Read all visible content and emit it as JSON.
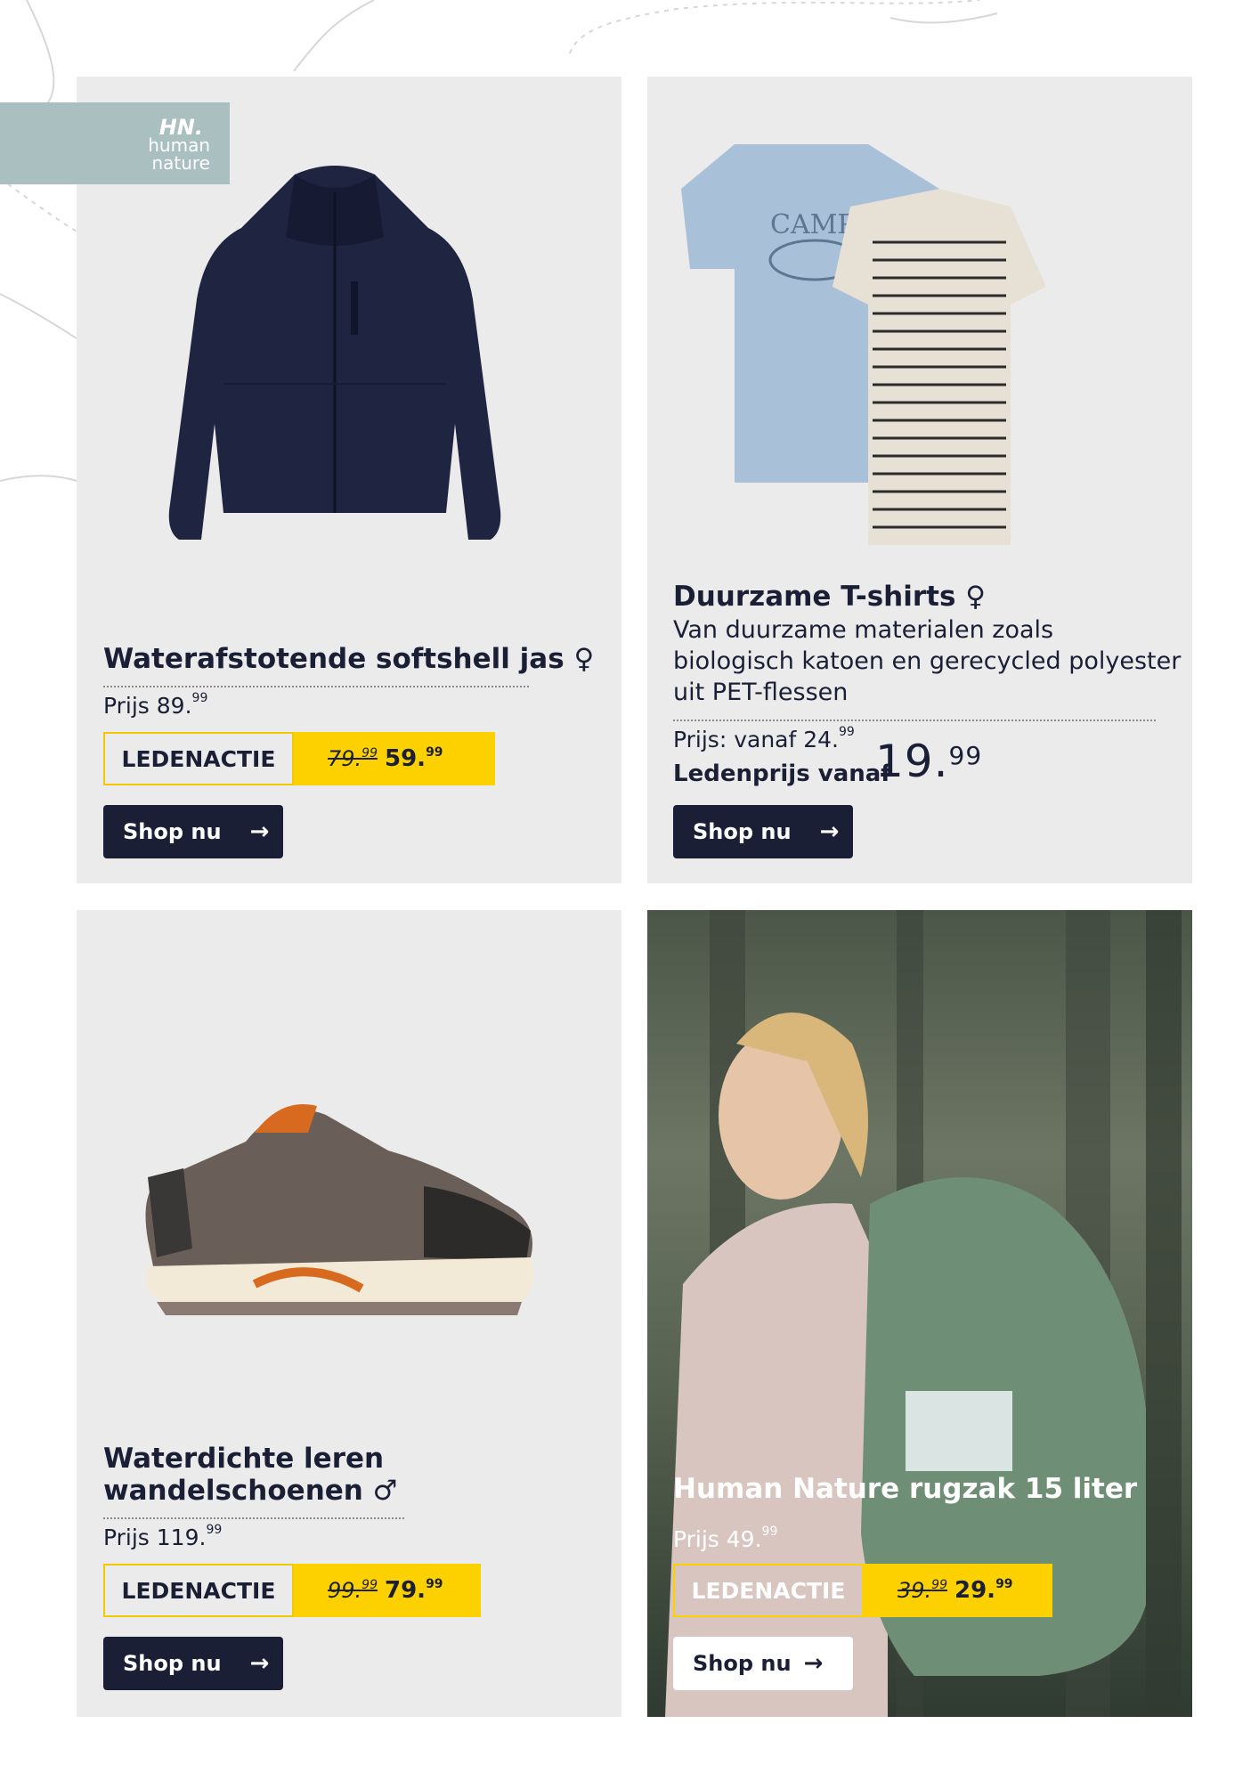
{
  "brand": {
    "mark": "HN.",
    "line1": "human",
    "line2": "nature",
    "color": "#a9bfc0"
  },
  "colors": {
    "navy": "#1a1f36",
    "yellow": "#fdd100",
    "card": "#ebebeb"
  },
  "products": [
    {
      "title": "Waterafstotende softshell jas ♀",
      "price_label": "Prijs 89.",
      "price_cents": "99",
      "member_label": "LEDENACTIE",
      "old_price": "79.",
      "old_cents": "99",
      "new_price": "59.",
      "new_cents": "99",
      "button": "Shop nu"
    },
    {
      "title": "Duurzame T-shirts ♀",
      "description_1": "Van duurzame materialen zoals",
      "description_2": "biologisch katoen en gerecycled polyester",
      "description_3": "uit PET-flessen",
      "price_label": "Prijs: vanaf 24.",
      "price_cents": "99",
      "member_price_label": "Ledenprijs  vanaf",
      "member_price": "19.",
      "member_cents": "99",
      "button": "Shop nu"
    },
    {
      "title_1": "Waterdichte leren",
      "title_2": "wandelschoenen ♂",
      "price_label": "Prijs 119.",
      "price_cents": "99",
      "member_label": "LEDENACTIE",
      "old_price": "99.",
      "old_cents": "99",
      "new_price": "79.",
      "new_cents": "99",
      "button": "Shop nu"
    },
    {
      "title": "Human Nature rugzak 15 liter",
      "price_label": "Prijs 49.",
      "price_cents": "99",
      "member_label": "LEDENACTIE",
      "old_price": "39.",
      "old_cents": "99",
      "new_price": "29.",
      "new_cents": "99",
      "button": "Shop nu"
    }
  ],
  "icons": [
    "arrow-right-icon",
    "female-icon",
    "male-icon"
  ]
}
